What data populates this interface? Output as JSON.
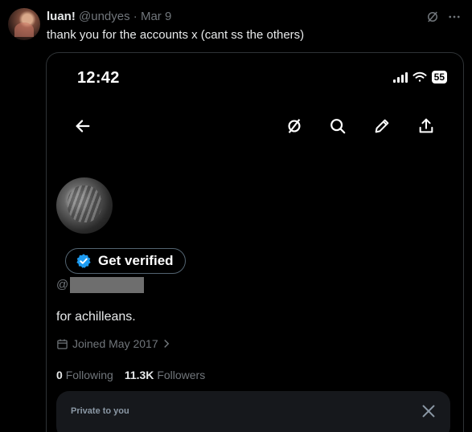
{
  "tweet": {
    "author_name": "luan!",
    "author_handle": "@undyes",
    "separator": "·",
    "date": "Mar 9",
    "text": "thank you for the accounts x (cant ss the others)",
    "icons": [
      "grok-icon",
      "more-icon"
    ]
  },
  "phone": {
    "time": "12:42",
    "battery": "55",
    "nav_icons": [
      "back-arrow-icon",
      "grok-icon",
      "search-icon",
      "edit-icon",
      "share-icon"
    ],
    "verified_label": "Get verified",
    "handle_prefix": "@",
    "bio": "for achilleans.",
    "joined": "Joined May 2017",
    "following_count": "0",
    "following_label": "Following",
    "followers_count": "11.3K",
    "followers_label": "Followers",
    "private_label": "Private to you",
    "accent_color": "#1d9bf0"
  }
}
